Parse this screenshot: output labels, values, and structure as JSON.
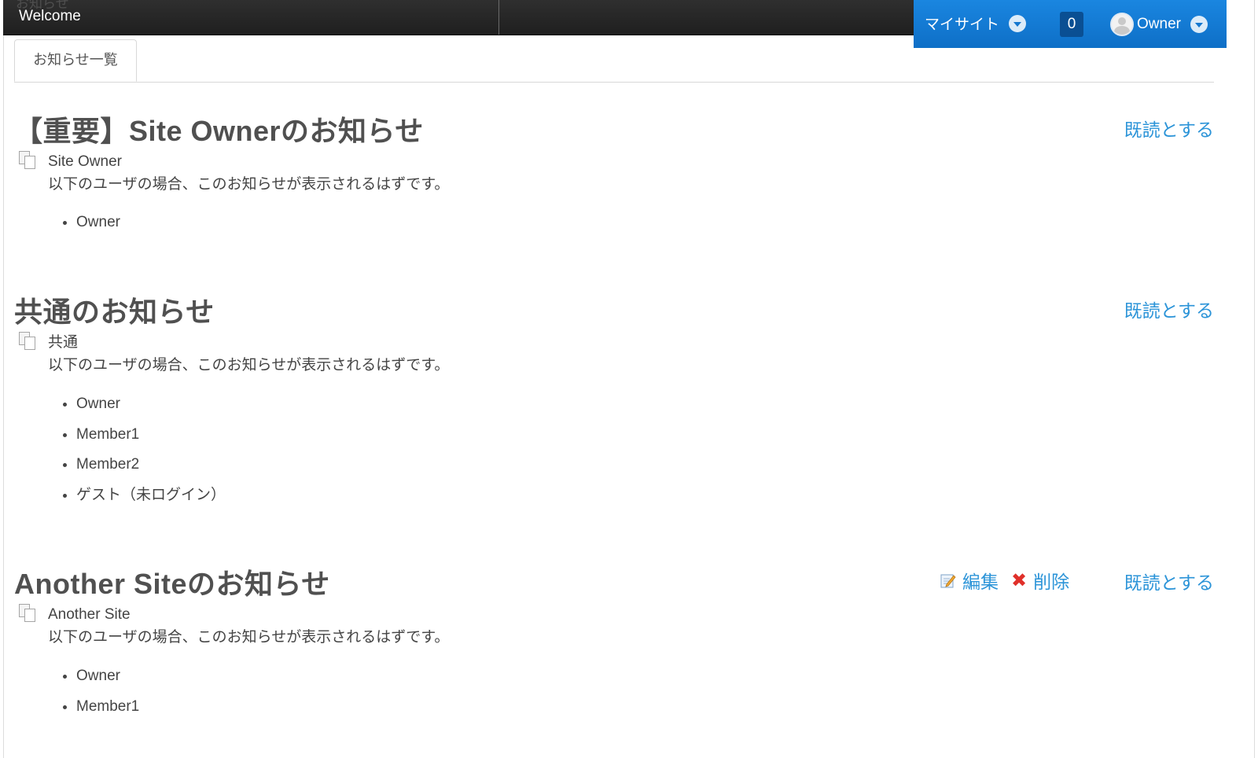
{
  "topbar": {
    "ghost_text": "お知らせ",
    "title": "Welcome"
  },
  "userbar": {
    "my_site_label": "マイサイト",
    "notification_count": "0",
    "user_name": "Owner"
  },
  "tabs": [
    {
      "label": "お知らせ一覧"
    }
  ],
  "notices": [
    {
      "title": "【重要】Site Ownerのお知らせ",
      "source": "Site Owner",
      "message": "以下のユーザの場合、このお知らせが表示されるはずです。",
      "users": [
        "Owner"
      ],
      "mark_read_label": "既読とする"
    },
    {
      "title": "共通のお知らせ",
      "source": "共通",
      "message": "以下のユーザの場合、このお知らせが表示されるはずです。",
      "users": [
        "Owner",
        "Member1",
        "Member2",
        "ゲスト（未ログイン）"
      ],
      "mark_read_label": "既読とする"
    },
    {
      "title": "Another Siteのお知らせ",
      "source": "Another Site",
      "message": "以下のユーザの場合、このお知らせが表示されるはずです。",
      "users": [
        "Owner",
        "Member1"
      ],
      "edit_label": "編集",
      "delete_label": "削除",
      "mark_read_label": "既読とする"
    }
  ],
  "icons": {
    "copy": "copy-icon",
    "edit": "edit-icon",
    "delete": "delete-icon",
    "caret": "chevron-down-icon",
    "avatar": "user-avatar-icon"
  },
  "colors": {
    "topbar": "#242424",
    "userbar": "#1178d4",
    "link": "#2c94d8",
    "delete": "#e0302a"
  }
}
